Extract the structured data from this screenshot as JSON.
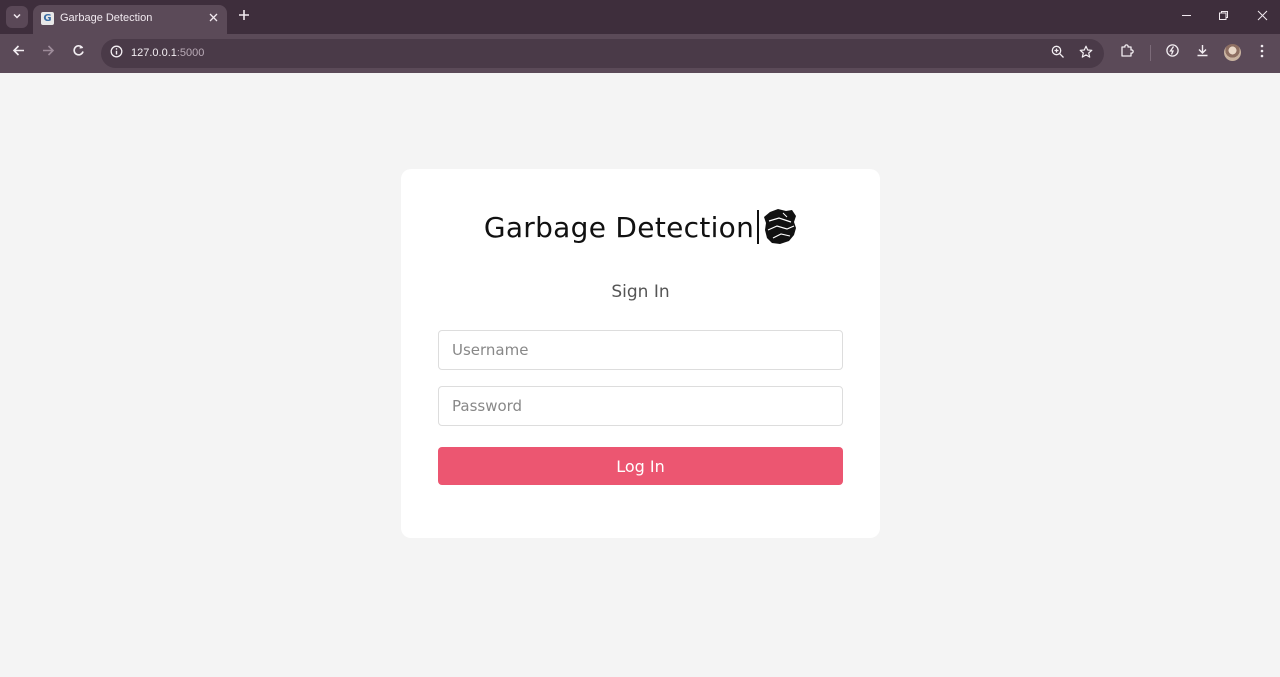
{
  "browser": {
    "tab": {
      "title": "Garbage Detection",
      "favicon_letter": "G"
    },
    "address_bar": {
      "host": "127.0.0.1",
      "port": ":5000"
    },
    "icons": [
      "tab-list-icon",
      "close-icon",
      "plus-icon",
      "minimize-icon",
      "restore-icon",
      "window-close-icon",
      "back-arrow-icon",
      "forward-arrow-icon",
      "reload-icon",
      "info-icon",
      "zoom-icon",
      "star-icon",
      "extensions-icon",
      "performance-icon",
      "download-icon",
      "profile-avatar",
      "more-vert-icon"
    ]
  },
  "page": {
    "brand": {
      "title": "Garbage Detection"
    },
    "signin_title": "Sign In",
    "username": {
      "placeholder": "Username",
      "value": ""
    },
    "password": {
      "placeholder": "Password",
      "value": ""
    },
    "login_label": "Log In"
  },
  "colors": {
    "page_background": "#f4f4f4",
    "card_background": "#ffffff",
    "login_button": "#ec5671",
    "tabstrip": "#3e2e3c",
    "toolbar": "#5b4a58"
  }
}
